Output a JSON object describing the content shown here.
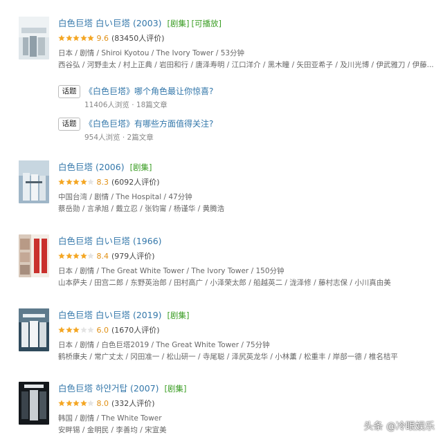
{
  "colors": {
    "link": "#3377aa",
    "tag": "#3a9d23",
    "star": "#f4a623",
    "score": "#e09015"
  },
  "results": [
    {
      "title": "白色巨塔 白い巨塔",
      "year": "(2003)",
      "tags": [
        "[剧集]",
        "[可播放]"
      ],
      "stars": 5,
      "score": "9.6",
      "count": "(83450人评价)",
      "meta": "日本 / 剧情 / Shiroi Kyotou / The Ivory Tower / 53分钟",
      "cast": "西谷弘 / 河野圭太 / 村上正典 / 岩田和行 / 唐泽寿明 / 江口洋介 / 黑木瞳 / 矢田亚希子 / 及川光博 / 伊武雅刀 / 伊藤..."
    },
    {
      "title": "白色巨塔",
      "year": "(2006)",
      "tags": [
        "[剧集]"
      ],
      "stars": 4,
      "score": "8.3",
      "count": "(6092人评价)",
      "meta": "中国台湾 / 剧情 / The Hospital / 47分钟",
      "cast": "蔡岳勋 / 言承旭 / 戴立忍 / 张钧甯 / 杨谨华 / 黄腾浩"
    },
    {
      "title": "白色巨塔 白い巨塔",
      "year": "(1966)",
      "tags": [],
      "stars": 4,
      "score": "8.4",
      "count": "(979人评价)",
      "meta": "日本 / 剧情 / The Great White Tower / The Ivory Tower / 150分钟",
      "cast": "山本萨夫 / 田宫二郎 / 东野英治郎 / 田村高广 / 小泽荣太郎 / 船越英二 / 泷泽修 / 藤村志保 / 小川真由美"
    },
    {
      "title": "白色巨塔 白い巨塔",
      "year": "(2019)",
      "tags": [
        "[剧集]"
      ],
      "stars": 3,
      "score": "6.0",
      "count": "(1670人评价)",
      "meta": "日本 / 剧情 / 白色巨塔2019 / The Great White Tower / 75分钟",
      "cast": "鹤桥康夫 / 常广丈太 / 冈田准一 / 松山研一 / 寺尾聪 / 泽尻英龙华 / 小林薰 / 松重丰 / 岸部一德 / 椎名桔平"
    },
    {
      "title": "白色巨塔 하얀거탑",
      "year": "(2007)",
      "tags": [
        "[剧集]"
      ],
      "stars": 4,
      "score": "8.0",
      "count": "(332人评价)",
      "meta": "韩国 / 剧情 / The White Tower",
      "cast": "安畔锡 / 金明民 / 李善均 / 宋宣美"
    }
  ],
  "topics": [
    {
      "button": "话题",
      "title": "《白色巨塔》哪个角色最让你惊喜?",
      "sub": "11406人浏览 · 18篇文章"
    },
    {
      "button": "话题",
      "title": "《白色巨塔》有哪些方面值得关注?",
      "sub": "954人浏览 · 2篇文章"
    }
  ],
  "watermark": "头条 @冷眼娱乐"
}
